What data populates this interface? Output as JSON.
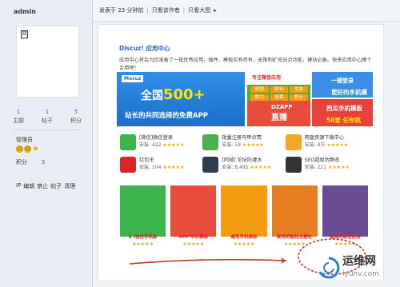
{
  "sidebar": {
    "username": "admin",
    "avatar_glyph": "回",
    "stats": [
      {
        "value": "1",
        "label": "主题"
      },
      {
        "value": "1",
        "label": "帖子"
      },
      {
        "value": "5",
        "label": "积分"
      }
    ],
    "role": "管理员",
    "points_label": "积分",
    "points_value": "5",
    "ops": [
      "IP",
      "编辑",
      "禁止",
      "帖子",
      "清理"
    ]
  },
  "topbar": {
    "posted": "发表于 23 分钟前",
    "only_author": "只看该作者",
    "only_big": "只看大图",
    "arrow": "▸"
  },
  "content": {
    "title": "Discuz! 应用中心",
    "description": "应用中心将会为您准备了一批优秀应用，插件、模板应有尽有，无限制扩充站点功能，建站必备。快来应用中心瞧个合用吧！",
    "banner_left": {
      "logo": "Mocuz",
      "brand": "Mocuz",
      "big": "全国500+",
      "big_num": "500+",
      "sub": "站长的共同选择的免费APP"
    },
    "banner_mid": {
      "top": "专注微信应用",
      "tags": [
        "拼团",
        "砍价",
        "交友",
        "助力",
        "投票",
        "积分"
      ],
      "dz": "DZAPP",
      "dz_sub": "直播"
    },
    "banner_right": {
      "top": "一键登录",
      "top_sub": "更好的手机模板",
      "bot": "西瓜手机模板",
      "bot_sub": "50套 任你挑"
    },
    "list": [
      {
        "title": "[微信]微信登录",
        "sub": "安装: 422",
        "color": "#3bb44a"
      },
      {
        "title": "批量注册马甲点赞",
        "sub": "安装: 59",
        "color": "#4caf50"
      },
      {
        "title": "网盘资源下载中心",
        "sub": "安装: 4万",
        "color": "#f5a623"
      },
      {
        "title": "红包王",
        "sub": "安装: 104",
        "color": "#d9262c"
      },
      {
        "title": "[同城] 论坛防灌水",
        "sub": "安装: 8,495",
        "color": "#2c3e50"
      },
      {
        "title": "SEO超级伪静态",
        "sub": "安装: 221",
        "color": "#333333"
      }
    ],
    "cards": [
      {
        "label": "$ !微信手机版",
        "color": "#3bb44a"
      },
      {
        "label": "APP!手机模板",
        "color": "#e84c3d"
      },
      {
        "label": "威免手机模板",
        "color": "#f39c12"
      },
      {
        "label": "新悦的贴轻主题社",
        "color": "#e67e22"
      },
      {
        "label": "最美的微信应用",
        "color": "#6a4c93"
      }
    ],
    "stars": "★★★★★"
  },
  "watermark": {
    "line1": "运维网",
    "line2": "iyunv.com"
  }
}
